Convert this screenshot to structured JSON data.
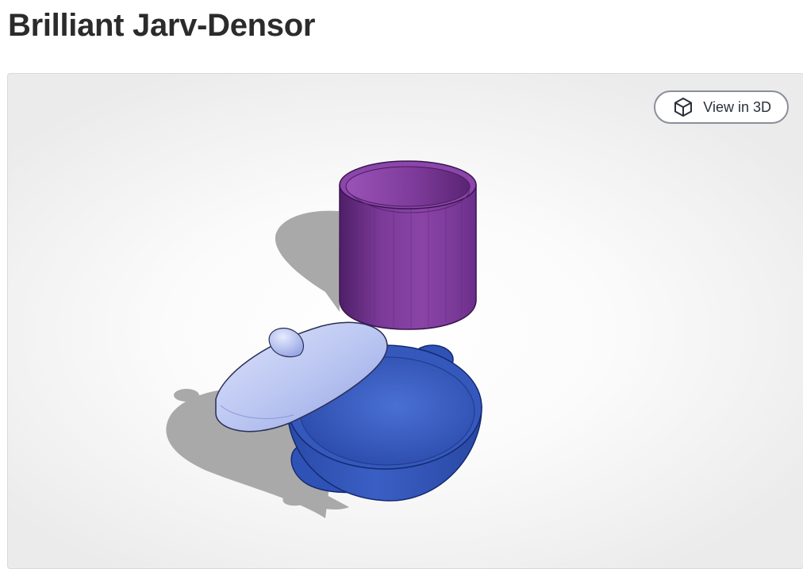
{
  "page": {
    "title": "Brilliant Jarv-Densor"
  },
  "viewer": {
    "view_3d_button": {
      "label": "View in 3D",
      "icon": "cube-icon"
    },
    "model_parts": [
      {
        "name": "cylinder",
        "color": "#8040a0"
      },
      {
        "name": "lid",
        "color": "#b8c4f0"
      },
      {
        "name": "bowl",
        "color": "#3a5fc4"
      }
    ],
    "colors": {
      "purple": "#8040a0",
      "lid": "#b8c4f0",
      "blue": "#3a5fc4",
      "shadow": "#a9a9a9"
    }
  }
}
